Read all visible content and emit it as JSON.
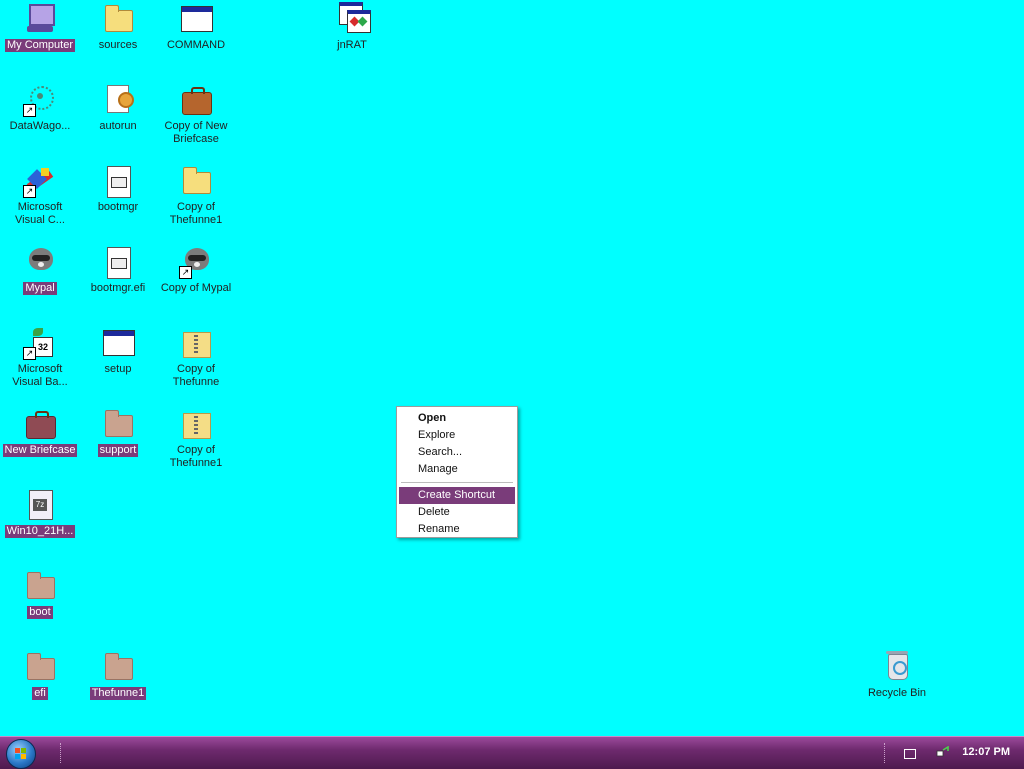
{
  "desktop": {
    "background_color": "#00FFFF",
    "selection_color": "#7A3C7A",
    "icons": [
      {
        "label": "My Computer",
        "icon": "my-computer-icon",
        "selected": true
      },
      {
        "label": "sources",
        "icon": "folder-icon"
      },
      {
        "label": "COMMAND",
        "icon": "command-window-icon"
      },
      {
        "label": "jnRAT",
        "icon": "jnrat-app-icon"
      },
      {
        "label": "DataWago...",
        "icon": "datawagon-shortcut-icon"
      },
      {
        "label": "autorun",
        "icon": "autorun-settings-icon"
      },
      {
        "label": "Copy of New Briefcase",
        "icon": "briefcase-icon"
      },
      {
        "label": "Microsoft Visual C...",
        "icon": "visual-c-shortcut-icon"
      },
      {
        "label": "bootmgr",
        "icon": "system-file-icon"
      },
      {
        "label": "Copy of Thefunne1",
        "icon": "folder-icon"
      },
      {
        "label": "Mypal",
        "icon": "mypal-browser-icon",
        "selected": true
      },
      {
        "label": "bootmgr.efi",
        "icon": "system-file-icon"
      },
      {
        "label": "Copy of Mypal",
        "icon": "mypal-shortcut-icon"
      },
      {
        "label": "Microsoft Visual Ba...",
        "icon": "visual-basic-shortcut-icon"
      },
      {
        "label": "setup",
        "icon": "setup-window-icon"
      },
      {
        "label": "Copy of Thefunne",
        "icon": "zipped-folder-icon"
      },
      {
        "label": "New Briefcase",
        "icon": "briefcase-icon",
        "selected": true
      },
      {
        "label": "support",
        "icon": "folder-icon",
        "selected": true
      },
      {
        "label": "Copy of Thefunne1",
        "icon": "zipped-folder-icon"
      },
      {
        "label": "Win10_21H...",
        "icon": "7z-archive-icon",
        "selected": true
      },
      {
        "label": "boot",
        "icon": "folder-icon",
        "selected": true
      },
      {
        "label": "efi",
        "icon": "folder-icon",
        "selected": true
      },
      {
        "label": "Thefunne1",
        "icon": "folder-icon",
        "selected": true
      },
      {
        "label": "Recycle Bin",
        "icon": "recycle-bin-icon"
      }
    ]
  },
  "context_menu": {
    "items": [
      {
        "label": "Open",
        "bold": true
      },
      {
        "label": "Explore"
      },
      {
        "label": "Search..."
      },
      {
        "label": "Manage"
      },
      {
        "label": "Create Shortcut",
        "highlighted": true
      },
      {
        "label": "Delete"
      },
      {
        "label": "Rename"
      }
    ]
  },
  "taskbar": {
    "clock": "12:07 PM",
    "start_icon": "windows-start-orb-icon",
    "tray_icons": [
      "keyboard-icon",
      "network-icon"
    ]
  }
}
